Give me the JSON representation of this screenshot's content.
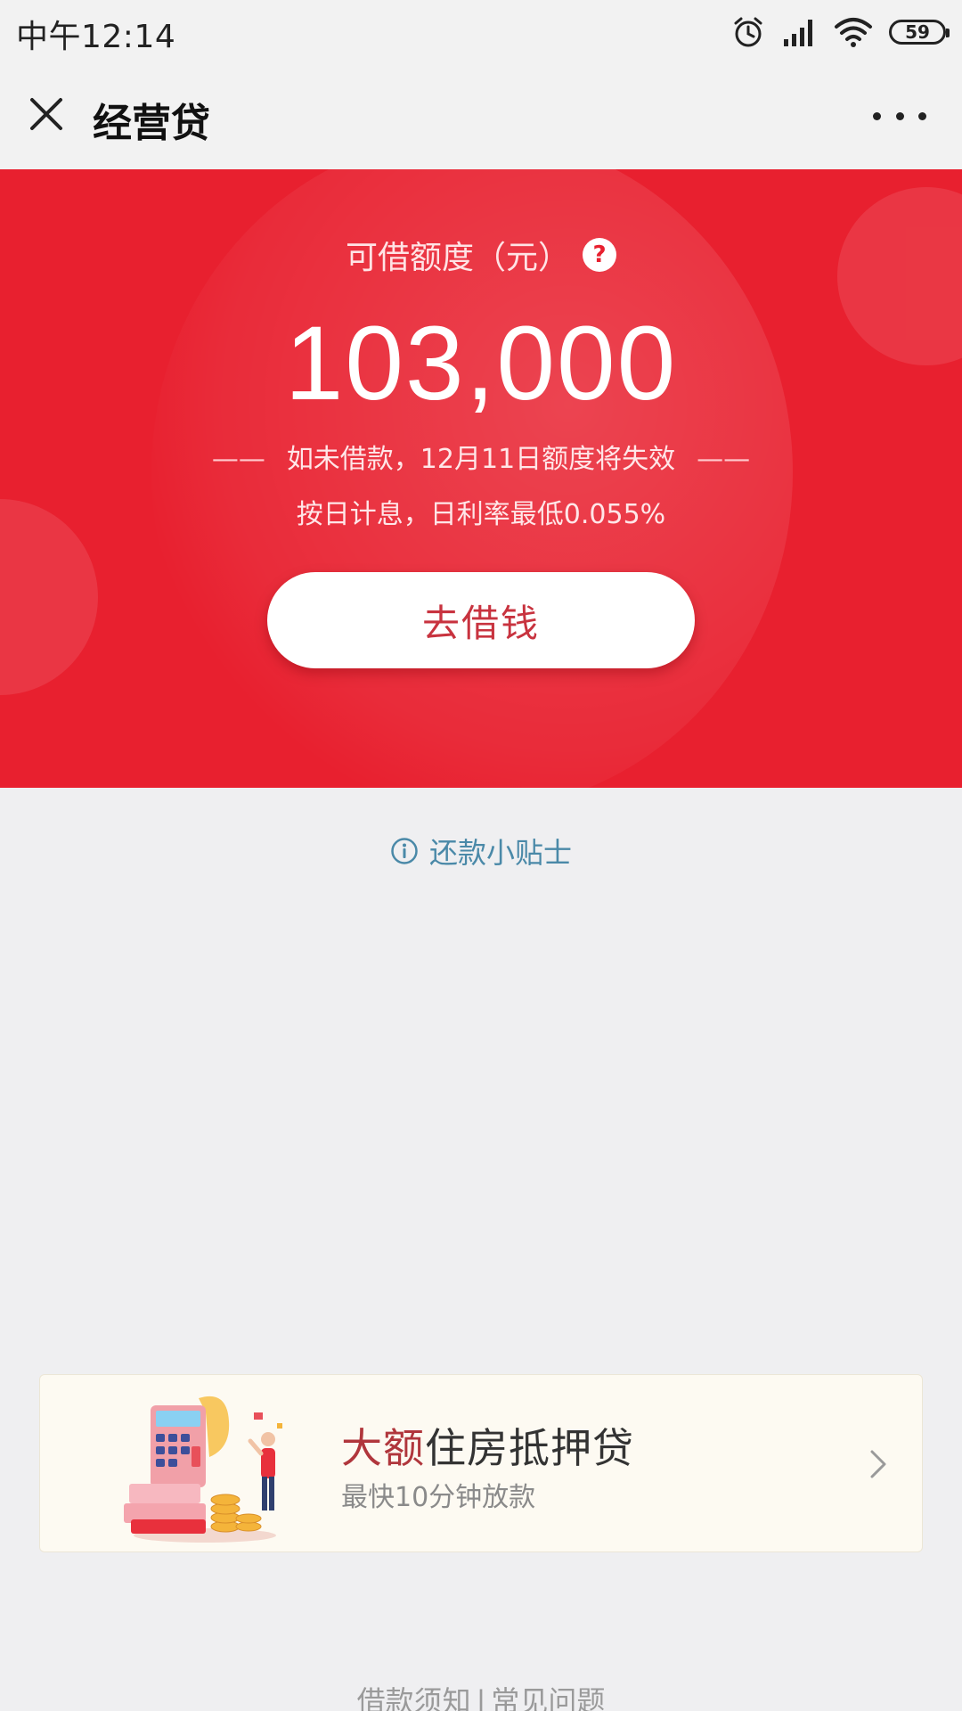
{
  "status_bar": {
    "time": "中午12:14",
    "battery": "59",
    "icons": [
      "alarm-icon",
      "signal-icon",
      "wifi-icon",
      "battery-icon"
    ]
  },
  "nav": {
    "title": "经营贷",
    "close_icon": "close-icon",
    "more_icon": "more-icon"
  },
  "hero": {
    "label": "可借额度（元）",
    "help_symbol": "?",
    "amount": "103,000",
    "notice_dash": "——",
    "notice": "如未借款，12月11日额度将失效",
    "rate": "按日计息，日利率最低0.055%",
    "button_label": "去借钱",
    "colors": {
      "background": "#e8202f",
      "button_text": "#c8333f"
    }
  },
  "tips": {
    "icon": "info-icon",
    "label": "还款小贴士"
  },
  "promo": {
    "title_accent": "大额",
    "title_rest": "住房抵押贷",
    "subtitle": "最快10分钟放款",
    "illustration": "calculator-money-illustration",
    "chevron": "chevron-right-icon"
  },
  "footer": {
    "link1": "借款须知",
    "separator": "|",
    "link2": "常见问题"
  }
}
